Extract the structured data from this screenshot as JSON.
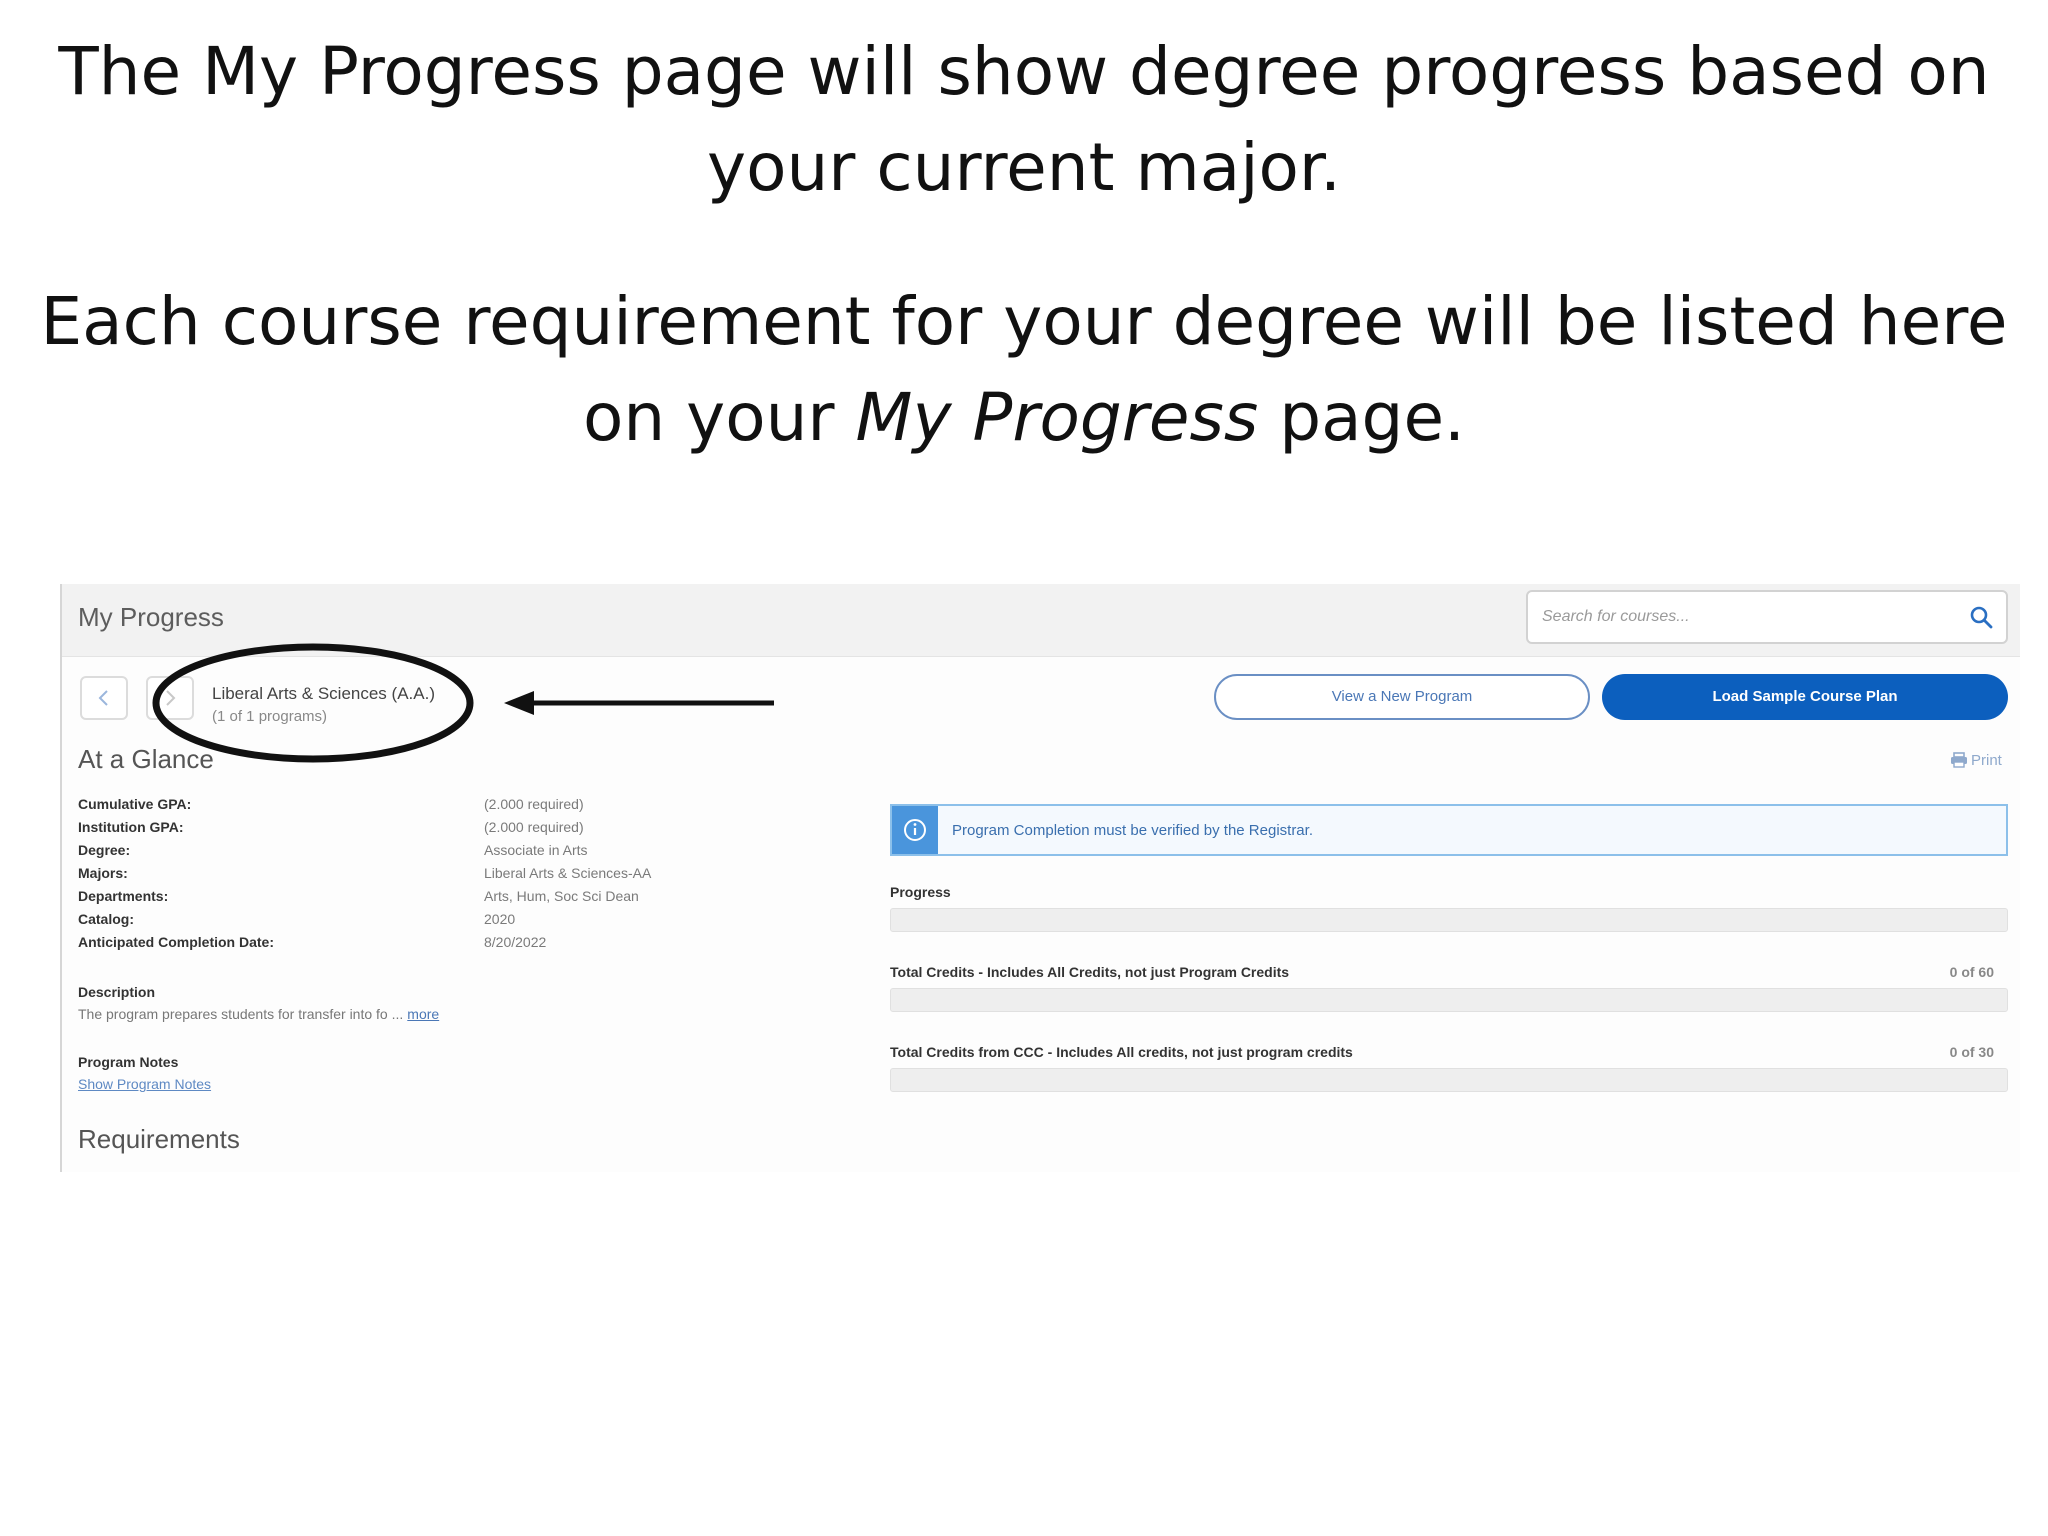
{
  "slide": {
    "line1": "The My Progress page will show degree progress based on your current major.",
    "line2_before": "Each course requirement for your degree will be listed here on your ",
    "line2_emphasis": "My Progress",
    "line2_after": " page."
  },
  "screenshot": {
    "page_title": "My Progress",
    "search": {
      "placeholder": "Search for courses..."
    },
    "program": {
      "name": "Liberal Arts & Sciences (A.A.)",
      "count": "(1 of 1 programs)"
    },
    "buttons": {
      "view_program": "View a New Program",
      "load_plan": "Load Sample Course Plan"
    },
    "glance": {
      "heading": "At a Glance",
      "print": "Print",
      "rows": [
        {
          "label": "Cumulative GPA:",
          "value": "(2.000 required)"
        },
        {
          "label": "Institution GPA:",
          "value": "(2.000 required)"
        },
        {
          "label": "Degree:",
          "value": "Associate in Arts"
        },
        {
          "label": "Majors:",
          "value": "Liberal Arts & Sciences-AA"
        },
        {
          "label": "Departments:",
          "value": "Arts, Hum, Soc Sci Dean"
        },
        {
          "label": "Catalog:",
          "value": "2020"
        },
        {
          "label": "Anticipated Completion Date:",
          "value": "8/20/2022"
        }
      ],
      "description_label": "Description",
      "description_text": "The program prepares students for transfer into fo ...",
      "description_more": "more",
      "notes_label": "Program Notes",
      "notes_link": "Show Program Notes"
    },
    "alert": {
      "text": "Program Completion must be verified by the Registrar."
    },
    "progress": {
      "label": "Progress",
      "fraction": 0,
      "total_credits": {
        "label": "Total Credits - Includes All Credits, not just Program Credits",
        "count": "0 of 60",
        "fraction": 0
      },
      "ccc_credits": {
        "label": "Total Credits from CCC - Includes All credits, not just program credits",
        "count": "0 of 30",
        "fraction": 0
      }
    },
    "requirements_heading": "Requirements"
  },
  "colors": {
    "primary_button": "#0c5fbe",
    "alert_blue": "#4a95dc",
    "annotation": "#111111"
  }
}
